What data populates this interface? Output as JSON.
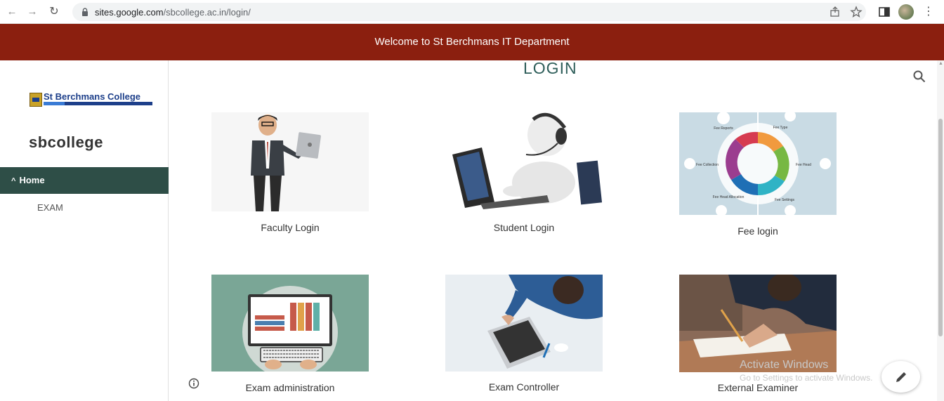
{
  "browser": {
    "url_host": "sites.google.com",
    "url_path": "/sbcollege.ac.in/login/"
  },
  "banner": {
    "text": "Welcome to St Berchmans IT Department"
  },
  "sidebar": {
    "logo_text": "St Berchmans College",
    "site_name": "sbcollege",
    "nav_items": [
      {
        "label": "Home",
        "icon": "chevron-up-icon",
        "active": true
      },
      {
        "label": "EXAM",
        "active": false
      }
    ]
  },
  "main": {
    "title": "LOGIN",
    "cards": [
      {
        "label": "Faculty Login",
        "image": "teacher-with-laptop-illustration"
      },
      {
        "label": "Student Login",
        "image": "3d-figure-with-headset-at-laptop"
      },
      {
        "label": "Fee login",
        "image": "fee-management-cycle-diagram",
        "diagram_labels": [
          "Fee Reports",
          "Fee Type",
          "Fee Collection",
          "Fee Head",
          "Fee Head Allocation",
          "Fee Settings"
        ]
      },
      {
        "label": "Exam administration",
        "image": "computer-with-books-illustration"
      },
      {
        "label": "Exam Controller",
        "image": "person-typing-on-laptop-photo"
      },
      {
        "label": "External Examiner",
        "image": "person-writing-exam-photo"
      }
    ]
  },
  "watermark": {
    "line1": "Activate Windows",
    "line2": "Go to Settings to activate Windows."
  },
  "colors": {
    "banner": "#8b1f0f",
    "nav_active": "#2e4e47",
    "title": "#2e5e5a"
  }
}
